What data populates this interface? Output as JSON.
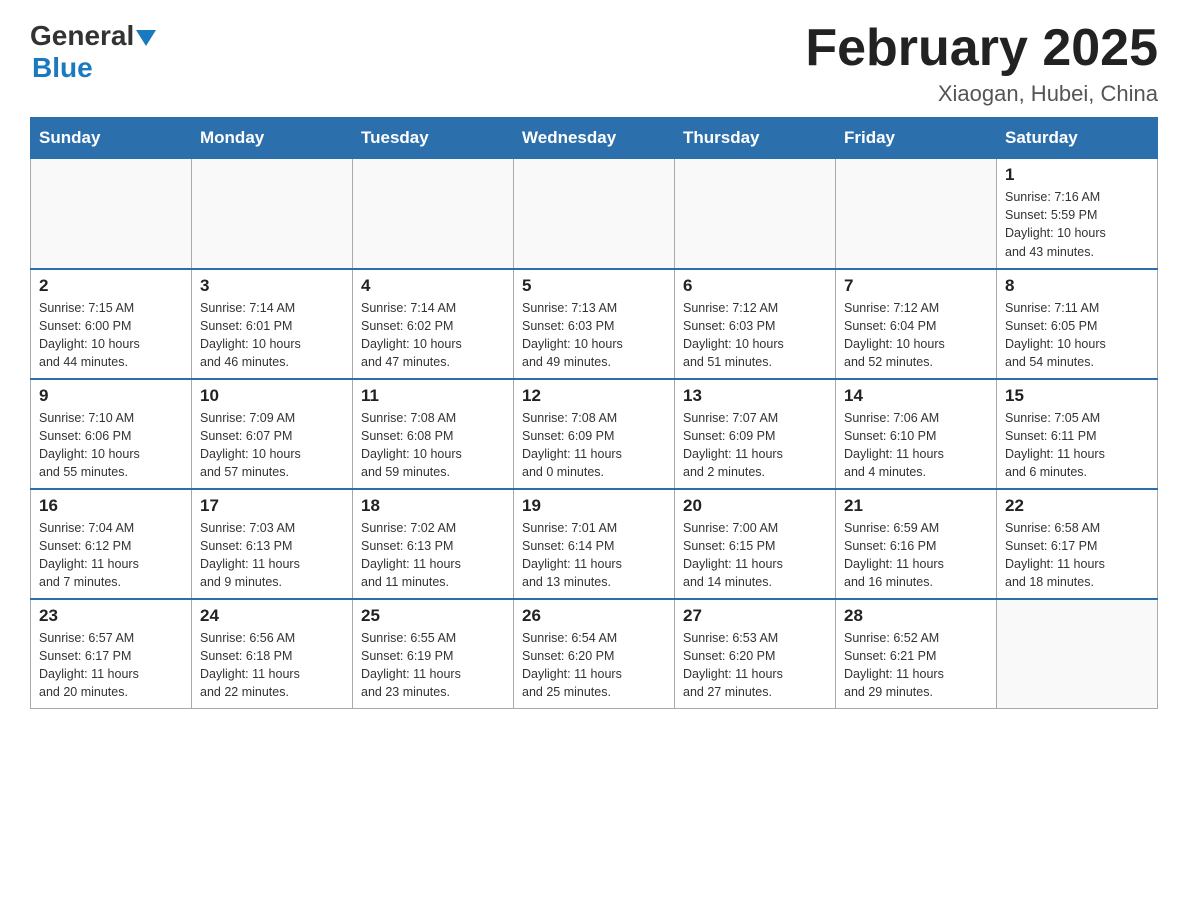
{
  "logo": {
    "general": "General",
    "blue": "Blue"
  },
  "title": "February 2025",
  "location": "Xiaogan, Hubei, China",
  "weekdays": [
    "Sunday",
    "Monday",
    "Tuesday",
    "Wednesday",
    "Thursday",
    "Friday",
    "Saturday"
  ],
  "weeks": [
    [
      {
        "day": "",
        "info": ""
      },
      {
        "day": "",
        "info": ""
      },
      {
        "day": "",
        "info": ""
      },
      {
        "day": "",
        "info": ""
      },
      {
        "day": "",
        "info": ""
      },
      {
        "day": "",
        "info": ""
      },
      {
        "day": "1",
        "info": "Sunrise: 7:16 AM\nSunset: 5:59 PM\nDaylight: 10 hours\nand 43 minutes."
      }
    ],
    [
      {
        "day": "2",
        "info": "Sunrise: 7:15 AM\nSunset: 6:00 PM\nDaylight: 10 hours\nand 44 minutes."
      },
      {
        "day": "3",
        "info": "Sunrise: 7:14 AM\nSunset: 6:01 PM\nDaylight: 10 hours\nand 46 minutes."
      },
      {
        "day": "4",
        "info": "Sunrise: 7:14 AM\nSunset: 6:02 PM\nDaylight: 10 hours\nand 47 minutes."
      },
      {
        "day": "5",
        "info": "Sunrise: 7:13 AM\nSunset: 6:03 PM\nDaylight: 10 hours\nand 49 minutes."
      },
      {
        "day": "6",
        "info": "Sunrise: 7:12 AM\nSunset: 6:03 PM\nDaylight: 10 hours\nand 51 minutes."
      },
      {
        "day": "7",
        "info": "Sunrise: 7:12 AM\nSunset: 6:04 PM\nDaylight: 10 hours\nand 52 minutes."
      },
      {
        "day": "8",
        "info": "Sunrise: 7:11 AM\nSunset: 6:05 PM\nDaylight: 10 hours\nand 54 minutes."
      }
    ],
    [
      {
        "day": "9",
        "info": "Sunrise: 7:10 AM\nSunset: 6:06 PM\nDaylight: 10 hours\nand 55 minutes."
      },
      {
        "day": "10",
        "info": "Sunrise: 7:09 AM\nSunset: 6:07 PM\nDaylight: 10 hours\nand 57 minutes."
      },
      {
        "day": "11",
        "info": "Sunrise: 7:08 AM\nSunset: 6:08 PM\nDaylight: 10 hours\nand 59 minutes."
      },
      {
        "day": "12",
        "info": "Sunrise: 7:08 AM\nSunset: 6:09 PM\nDaylight: 11 hours\nand 0 minutes."
      },
      {
        "day": "13",
        "info": "Sunrise: 7:07 AM\nSunset: 6:09 PM\nDaylight: 11 hours\nand 2 minutes."
      },
      {
        "day": "14",
        "info": "Sunrise: 7:06 AM\nSunset: 6:10 PM\nDaylight: 11 hours\nand 4 minutes."
      },
      {
        "day": "15",
        "info": "Sunrise: 7:05 AM\nSunset: 6:11 PM\nDaylight: 11 hours\nand 6 minutes."
      }
    ],
    [
      {
        "day": "16",
        "info": "Sunrise: 7:04 AM\nSunset: 6:12 PM\nDaylight: 11 hours\nand 7 minutes."
      },
      {
        "day": "17",
        "info": "Sunrise: 7:03 AM\nSunset: 6:13 PM\nDaylight: 11 hours\nand 9 minutes."
      },
      {
        "day": "18",
        "info": "Sunrise: 7:02 AM\nSunset: 6:13 PM\nDaylight: 11 hours\nand 11 minutes."
      },
      {
        "day": "19",
        "info": "Sunrise: 7:01 AM\nSunset: 6:14 PM\nDaylight: 11 hours\nand 13 minutes."
      },
      {
        "day": "20",
        "info": "Sunrise: 7:00 AM\nSunset: 6:15 PM\nDaylight: 11 hours\nand 14 minutes."
      },
      {
        "day": "21",
        "info": "Sunrise: 6:59 AM\nSunset: 6:16 PM\nDaylight: 11 hours\nand 16 minutes."
      },
      {
        "day": "22",
        "info": "Sunrise: 6:58 AM\nSunset: 6:17 PM\nDaylight: 11 hours\nand 18 minutes."
      }
    ],
    [
      {
        "day": "23",
        "info": "Sunrise: 6:57 AM\nSunset: 6:17 PM\nDaylight: 11 hours\nand 20 minutes."
      },
      {
        "day": "24",
        "info": "Sunrise: 6:56 AM\nSunset: 6:18 PM\nDaylight: 11 hours\nand 22 minutes."
      },
      {
        "day": "25",
        "info": "Sunrise: 6:55 AM\nSunset: 6:19 PM\nDaylight: 11 hours\nand 23 minutes."
      },
      {
        "day": "26",
        "info": "Sunrise: 6:54 AM\nSunset: 6:20 PM\nDaylight: 11 hours\nand 25 minutes."
      },
      {
        "day": "27",
        "info": "Sunrise: 6:53 AM\nSunset: 6:20 PM\nDaylight: 11 hours\nand 27 minutes."
      },
      {
        "day": "28",
        "info": "Sunrise: 6:52 AM\nSunset: 6:21 PM\nDaylight: 11 hours\nand 29 minutes."
      },
      {
        "day": "",
        "info": ""
      }
    ]
  ]
}
